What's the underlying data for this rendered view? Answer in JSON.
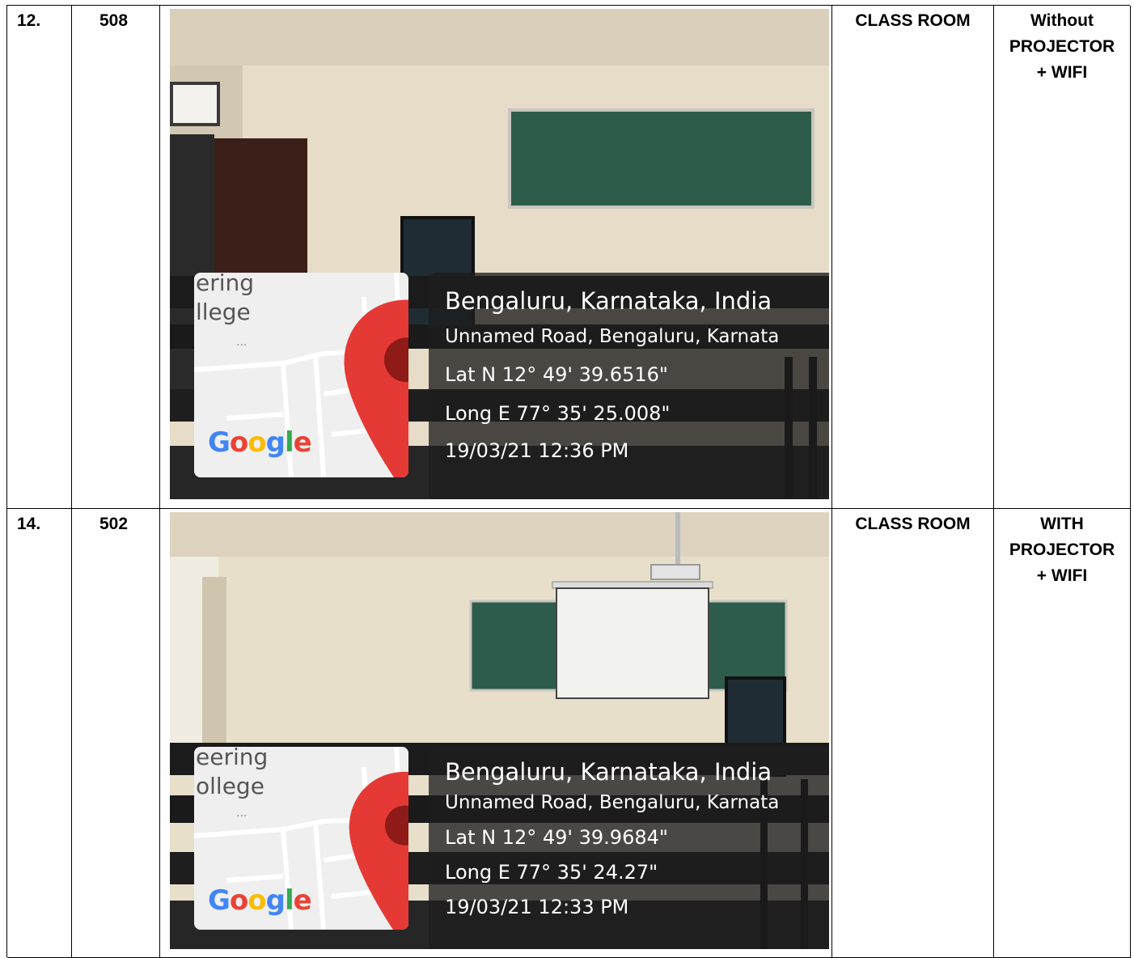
{
  "rows": [
    {
      "number": "12.",
      "room": "508",
      "type": "CLASS ROOM",
      "facility": [
        "Without",
        "PROJECTOR",
        "+ WIFI"
      ],
      "geotag": {
        "city": "Bengaluru, Karnataka, India",
        "road": "Unnamed Road, Bengaluru, Karnata",
        "lat": "Lat N 12° 49' 39.6516\"",
        "long": "Long E 77° 35' 25.008\"",
        "timestamp": "19/03/21 12:36 PM"
      },
      "map": {
        "label_1": "ering",
        "label_2": "llege",
        "ellipsis": "...",
        "brand": "Google"
      }
    },
    {
      "number": "14.",
      "room": "502",
      "type": "CLASS ROOM",
      "facility": [
        "WITH",
        "PROJECTOR",
        "+ WIFI"
      ],
      "geotag": {
        "city": "Bengaluru, Karnataka, India",
        "road": "Unnamed Road, Bengaluru, Karnata",
        "lat": "Lat N 12° 49' 39.9684\"",
        "long": "Long E 77° 35' 24.27\"",
        "timestamp": "19/03/21 12:33 PM"
      },
      "map": {
        "label_1": "eering",
        "label_2": "ollege",
        "ellipsis": "...",
        "brand": "Google"
      }
    }
  ],
  "colors": {
    "pin": "#e53935",
    "overlay": "#1e1e1e",
    "wall": "#e8dcc6",
    "board": "#2e5c4c",
    "screen": "#f2f2ef",
    "desk": "#2b2b2b"
  }
}
